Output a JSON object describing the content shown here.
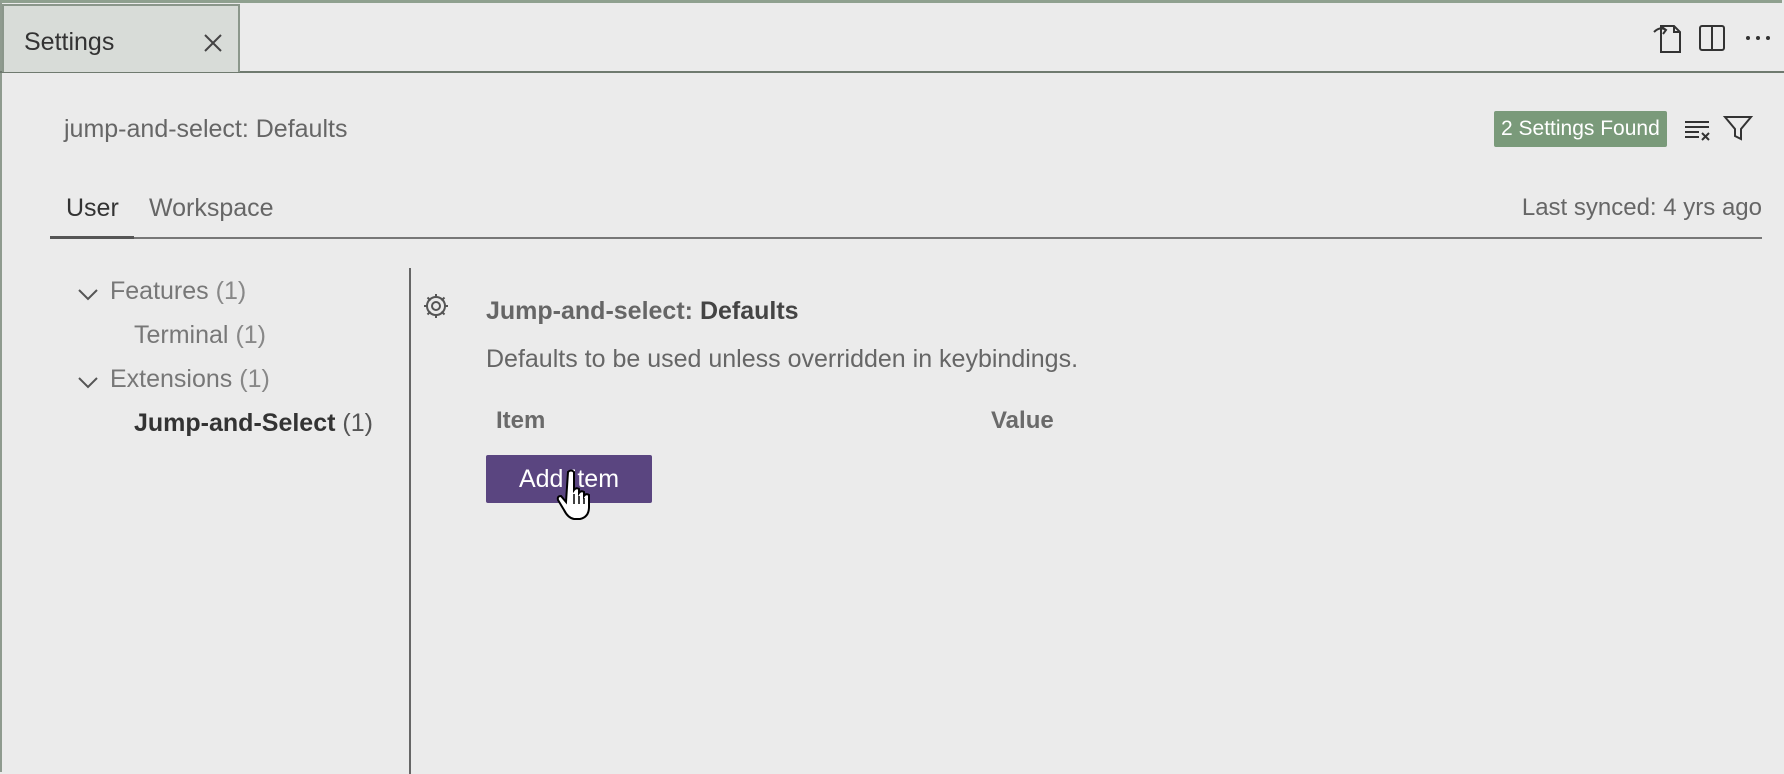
{
  "tab": {
    "label": "Settings"
  },
  "header": {
    "query": "jump-and-select: Defaults",
    "found_badge": "2 Settings Found"
  },
  "scope_tabs": [
    {
      "label": "User",
      "active": true
    },
    {
      "label": "Workspace",
      "active": false
    }
  ],
  "last_synced": "Last synced: 4 yrs ago",
  "toc": [
    {
      "label": "Features",
      "count": "(1)",
      "expanded": true
    },
    {
      "label": "Terminal",
      "count": "(1)"
    },
    {
      "label": "Extensions",
      "count": "(1)",
      "expanded": true
    },
    {
      "label": "Jump-and-Select",
      "count": "(1)",
      "selected": true
    }
  ],
  "setting": {
    "category": "Jump-and-select: ",
    "name": "Defaults",
    "description": "Defaults to be used unless overridden in keybindings.",
    "columns": [
      "Item",
      "Value"
    ],
    "add_button": "Add Item"
  },
  "icons": {
    "tab_close": "close-icon",
    "open_json": "open-settings-json-icon",
    "split_editor": "split-editor-icon",
    "more": "more-actions-icon",
    "clear": "clear-search-icon",
    "filter": "filter-icon",
    "gear": "gear-icon"
  },
  "colors": {
    "badge": "#7a9a7a",
    "button": "#5a4580",
    "background": "#ebebeb"
  }
}
